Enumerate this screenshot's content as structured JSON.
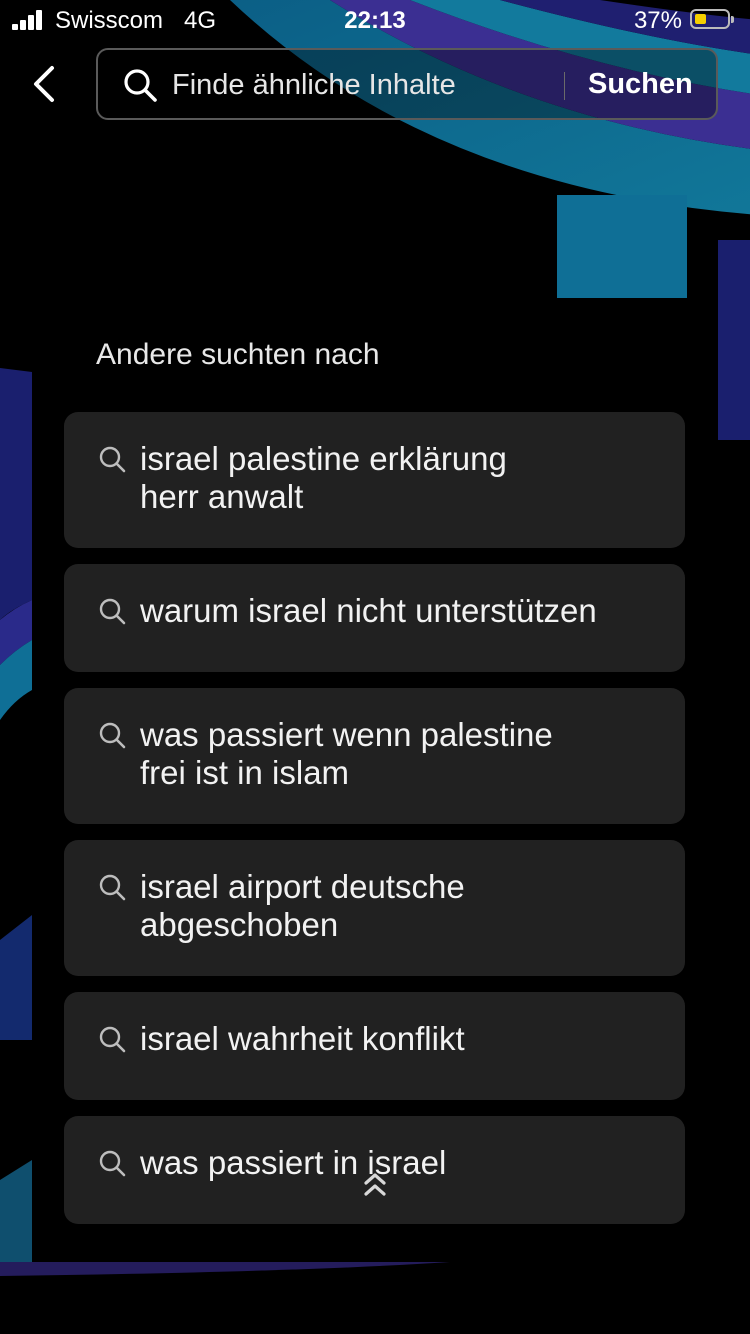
{
  "status_bar": {
    "carrier": "Swisscom",
    "network": "4G",
    "time": "22:13",
    "battery_percent": "37%",
    "battery_level": 0.37
  },
  "search": {
    "placeholder": "Finde ähnliche Inhalte",
    "button_label": "Suchen"
  },
  "suggestions": {
    "heading": "Andere suchten nach",
    "items": [
      {
        "label": "israel palestine erklärung\nherr anwalt"
      },
      {
        "label": "warum israel nicht unterstützen"
      },
      {
        "label": "was passiert wenn palestine\nfrei ist in islam"
      },
      {
        "label": "israel airport deutsche\nabgeschoben"
      },
      {
        "label": "israel wahrheit konflikt"
      },
      {
        "label": "was passiert in israel"
      }
    ]
  },
  "colors": {
    "background": "#000000",
    "card": "#212121",
    "accent_teal": "#0f6f96",
    "accent_purple": "#3a2f8f",
    "battery": "#f5d000"
  },
  "icons": [
    "back-chevron-icon",
    "search-icon",
    "chevron-up-icon"
  ]
}
